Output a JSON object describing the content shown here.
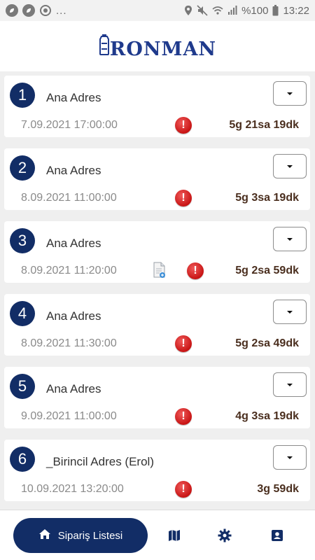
{
  "status_bar": {
    "left_dots": "...",
    "battery": "%100",
    "time": "13:22",
    "icons": [
      "leaf-icon",
      "leaf-icon",
      "sync-icon",
      "location-icon",
      "mute-icon",
      "wifi-icon",
      "signal-icon"
    ]
  },
  "header": {
    "logo_text": "RONMAN",
    "logo_icon": "water-bottle-icon"
  },
  "orders": [
    {
      "number": "1",
      "address": "Ana Adres",
      "date": "7.09.2021 17:00:00",
      "remaining": "5g 21sa 19dk",
      "has_doc": false
    },
    {
      "number": "2",
      "address": "Ana Adres",
      "date": "8.09.2021 11:00:00",
      "remaining": "5g 3sa 19dk",
      "has_doc": false
    },
    {
      "number": "3",
      "address": "Ana Adres",
      "date": "8.09.2021 11:20:00",
      "remaining": "5g 2sa 59dk",
      "has_doc": true
    },
    {
      "number": "4",
      "address": "Ana Adres",
      "date": "8.09.2021 11:30:00",
      "remaining": "5g 2sa 49dk",
      "has_doc": false
    },
    {
      "number": "5",
      "address": "Ana Adres",
      "date": "9.09.2021 11:00:00",
      "remaining": "4g 3sa 19dk",
      "has_doc": false
    },
    {
      "number": "6",
      "address": "_Birincil Adres (Erol)",
      "date": "10.09.2021 13:20:00",
      "remaining": "3g 59dk",
      "has_doc": false
    }
  ],
  "bottom_nav": {
    "primary_label": "Sipariş Listesi",
    "items": [
      "home-icon",
      "map-icon",
      "settings-icon",
      "contact-icon"
    ]
  },
  "colors": {
    "brand": "#122d66",
    "alert": "#d11a1a",
    "remaining_text": "#4a2e1e"
  }
}
